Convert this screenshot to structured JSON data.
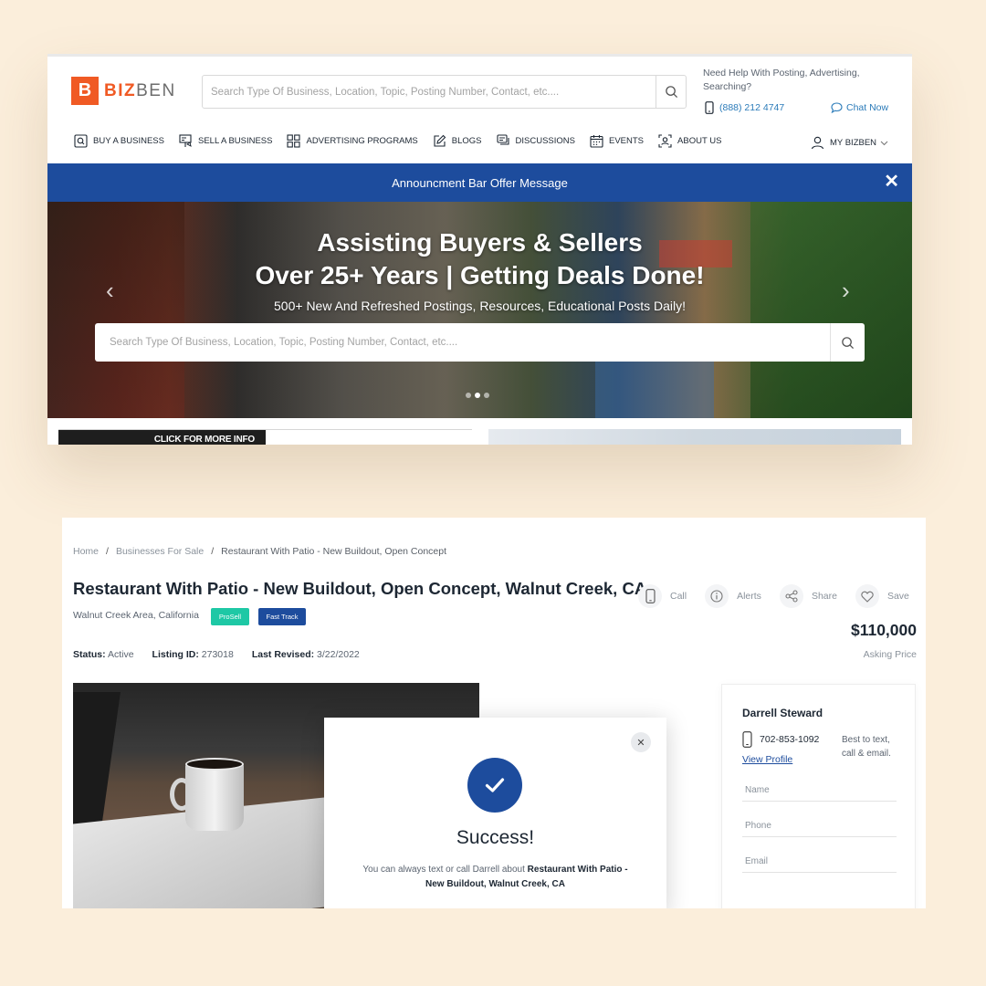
{
  "header": {
    "logo_letter": "B",
    "logo_biz": "BIZ",
    "logo_ben": "BEN",
    "search_placeholder": "Search Type Of Business, Location, Topic, Posting Number, Contact, etc....",
    "help_text": "Need Help With Posting, Advertising, Searching?",
    "phone": "(888) 212 4747",
    "chat_label": "Chat Now"
  },
  "nav": {
    "items": [
      {
        "label": "BUY A BUSINESS",
        "icon": "search-square-icon"
      },
      {
        "label": "SELL A BUSINESS",
        "icon": "sign-icon"
      },
      {
        "label": "ADVERTISING PROGRAMS",
        "icon": "grid-icon"
      },
      {
        "label": "BLOGS",
        "icon": "edit-icon"
      },
      {
        "label": "DISCUSSIONS",
        "icon": "chat-icon"
      },
      {
        "label": "EVENTS",
        "icon": "calendar-icon"
      },
      {
        "label": "ABOUT US",
        "icon": "focus-user-icon"
      }
    ],
    "my_bizben": "MY BIZBEN"
  },
  "announcement": {
    "text": "Announcment Bar Offer Message"
  },
  "hero": {
    "title_line1": "Assisting Buyers & Sellers",
    "title_line2": "Over 25+ Years | Getting Deals Done!",
    "subtitle": "500+ New And Refreshed Postings, Resources, Educational Posts Daily!",
    "search_placeholder": "Search Type Of Business, Location, Topic, Posting Number, Contact, etc....",
    "slides": 3,
    "active_slide": 2
  },
  "teaser": {
    "cta": "CLICK FOR MORE INFO"
  },
  "listing": {
    "breadcrumb": [
      "Home",
      "Businesses For Sale",
      "Restaurant With Patio - New Buildout, Open Concept"
    ],
    "title": "Restaurant With Patio - New Buildout, Open Concept, Walnut Creek, CA",
    "location": "Walnut Creek Area, California",
    "badges": [
      "ProSell",
      "Fast Track"
    ],
    "status_label": "Status:",
    "status": "Active",
    "listing_id_label": "Listing ID:",
    "listing_id": "273018",
    "revised_label": "Last Revised:",
    "revised": "3/22/2022",
    "actions": [
      "Call",
      "Alerts",
      "Share",
      "Save"
    ],
    "price": "$110,000",
    "price_label": "Asking Price"
  },
  "modal": {
    "title": "Success!",
    "message_prefix": "You can always text or call Darrell about",
    "message_bold": "Restaurant With Patio - New Buildout, Walnut Creek, CA"
  },
  "contact": {
    "name": "Darrell Steward",
    "phone": "702-853-1092",
    "view_profile": "View Profile",
    "hint": "Best to text, call & email.",
    "name_placeholder": "Name",
    "phone_placeholder": "Phone",
    "email_placeholder": "Email"
  },
  "colors": {
    "brand_orange": "#f05a24",
    "brand_blue": "#1d4c9d",
    "link_blue": "#2b7bb9",
    "prosell_green": "#1ec8a5",
    "background": "#fbeedb"
  }
}
